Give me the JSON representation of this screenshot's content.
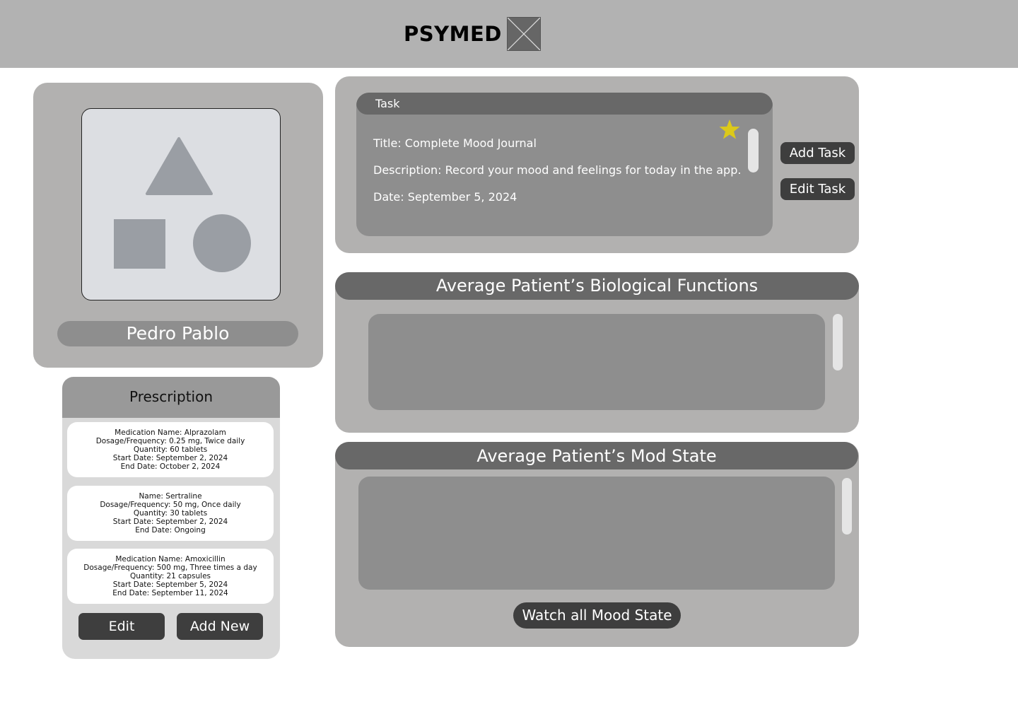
{
  "header": {
    "brand": "PSYMED",
    "logo_icon": "image-placeholder-icon"
  },
  "profile": {
    "avatar_icon": "shapes-placeholder-icon",
    "name": "Pedro Pablo"
  },
  "prescription": {
    "title": "Prescription",
    "items": [
      {
        "lines": [
          "Medication Name: Alprazolam",
          "Dosage/Frequency: 0.25 mg, Twice daily",
          "Quantity: 60 tablets",
          "Start Date: September 2, 2024",
          "End Date: October 2, 2024"
        ]
      },
      {
        "lines": [
          "Name: Sertraline",
          "Dosage/Frequency: 50 mg, Once daily",
          "Quantity: 30 tablets",
          "Start Date: September 2, 2024",
          "End Date: Ongoing"
        ]
      },
      {
        "lines": [
          "Medication Name: Amoxicillin",
          "Dosage/Frequency: 500 mg, Three times a day",
          "Quantity: 21 capsules",
          "Start Date: September 5, 2024",
          "End Date: September 11, 2024"
        ]
      }
    ],
    "edit_label": "Edit",
    "add_label": "Add New"
  },
  "task": {
    "header": "Task",
    "title_line": "Title: Complete Mood Journal",
    "description_line": "Description: Record your mood and feelings for today in the app.",
    "date_line": "Date: September 5, 2024",
    "star_icon": "star-icon",
    "star_color": "#dcc919",
    "add_label": "Add Task",
    "edit_label": "Edit Task"
  },
  "bio": {
    "title": "Average Patient’s Biological Functions"
  },
  "mood": {
    "title": "Average Patient’s Mod State",
    "watch_label": "Watch all Mood State"
  }
}
